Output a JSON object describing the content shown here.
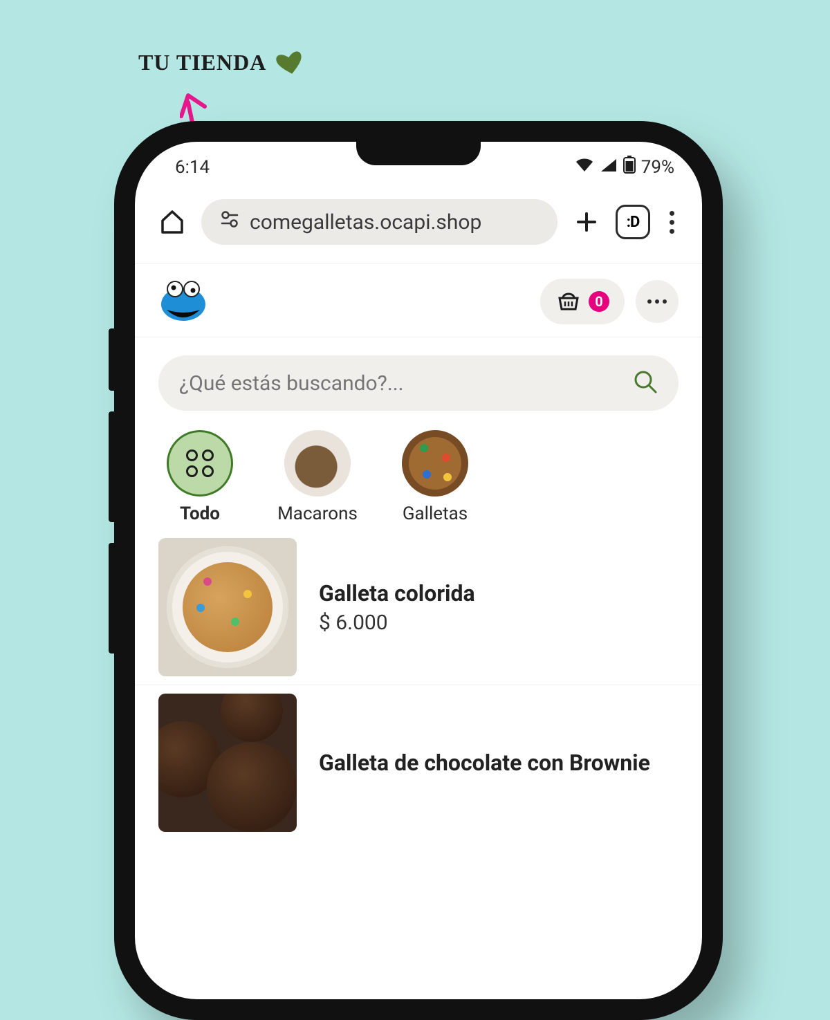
{
  "annotation": {
    "label": "TU TIENDA"
  },
  "status_bar": {
    "time": "6:14",
    "battery_pct": "79%"
  },
  "browser": {
    "url_text": "comegalletas.ocapi.shop",
    "tabs_badge": ":D"
  },
  "shop_header": {
    "cart_count": "0"
  },
  "search": {
    "placeholder": "¿Qué estás buscando?..."
  },
  "categories": [
    {
      "label": "Todo",
      "active": true
    },
    {
      "label": "Macarons",
      "active": false
    },
    {
      "label": "Galletas",
      "active": false
    }
  ],
  "products": [
    {
      "name": "Galleta colorida",
      "price": "$ 6.000"
    },
    {
      "name": "Galleta de chocolate con Brownie",
      "price": ""
    }
  ],
  "colors": {
    "bg": "#b4e7e3",
    "accent_pink": "#e6007e",
    "accent_green": "#3f7a27"
  }
}
